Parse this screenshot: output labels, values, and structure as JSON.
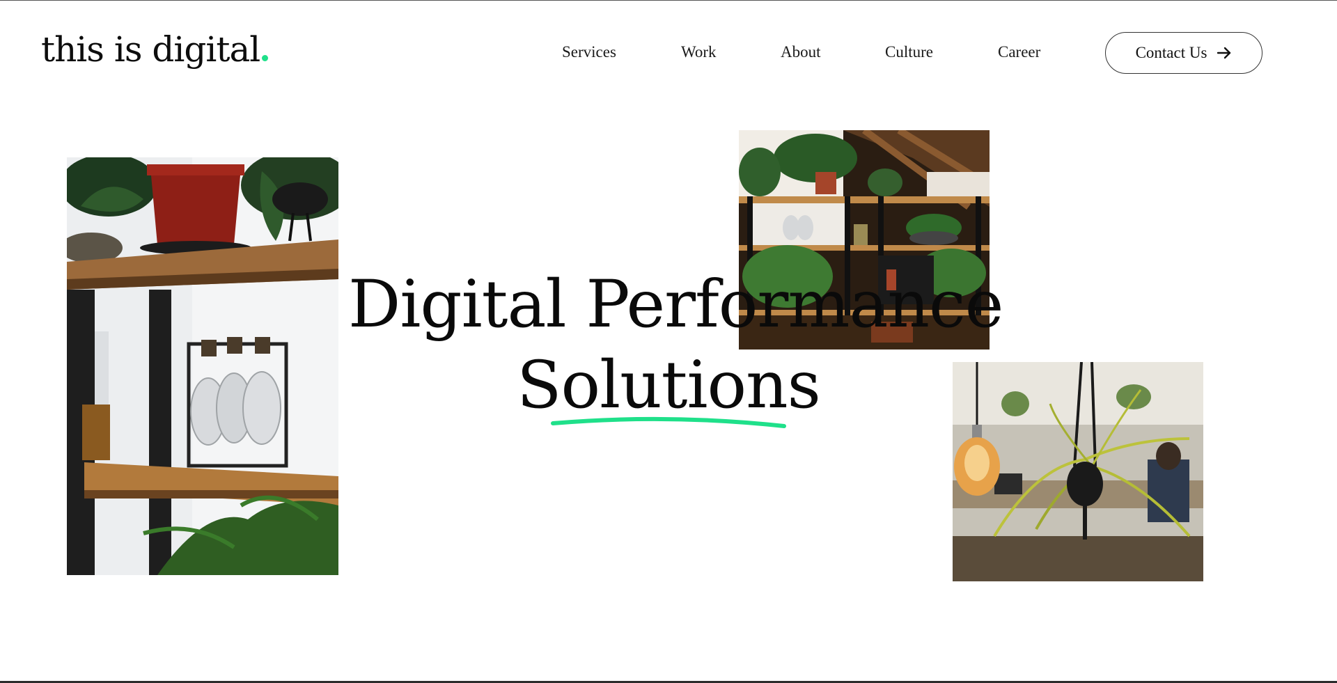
{
  "brand": {
    "logo_text": "this is digital",
    "accent_color": "#1fe08a"
  },
  "nav": {
    "items": [
      "Services",
      "Work",
      "About",
      "Culture",
      "Career"
    ],
    "contact_label": "Contact Us",
    "contact_icon": "arrow-right-icon"
  },
  "hero": {
    "line1": "Digital Performance",
    "line2": "Solutions"
  },
  "photos": [
    {
      "name": "shelf-plants-photo"
    },
    {
      "name": "office-shelves-photo"
    },
    {
      "name": "hanging-plant-bulb-photo"
    }
  ]
}
